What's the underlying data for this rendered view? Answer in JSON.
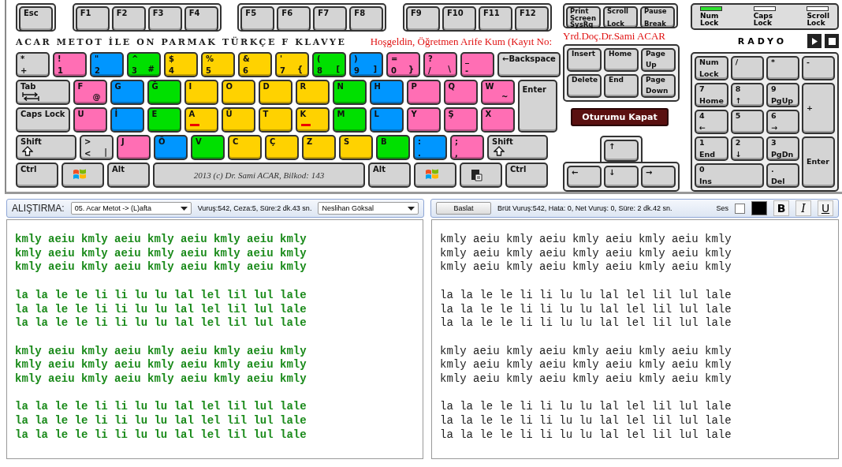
{
  "function_keys": [
    [
      {
        "label": [
          "Esc"
        ]
      }
    ],
    [
      {
        "label": [
          "F1"
        ]
      },
      {
        "label": [
          "F2"
        ]
      },
      {
        "label": [
          "F3"
        ]
      },
      {
        "label": [
          "F4"
        ]
      }
    ],
    [
      {
        "label": [
          "F5"
        ]
      },
      {
        "label": [
          "F6"
        ]
      },
      {
        "label": [
          "F7"
        ]
      },
      {
        "label": [
          "F8"
        ]
      }
    ],
    [
      {
        "label": [
          "F9"
        ]
      },
      {
        "label": [
          "F10"
        ]
      },
      {
        "label": [
          "F11"
        ]
      },
      {
        "label": [
          "F12"
        ]
      }
    ]
  ],
  "system_keys": [
    {
      "label": [
        "Print",
        "Screen",
        "SysRq"
      ]
    },
    {
      "label": [
        "Scroll",
        "Lock"
      ]
    },
    {
      "label": [
        "Pause",
        "Break"
      ]
    }
  ],
  "lock_indicators": [
    {
      "label": [
        "Num",
        "Lock"
      ],
      "on": true
    },
    {
      "label": [
        "Caps",
        "Lock"
      ],
      "on": false
    },
    {
      "label": [
        "Scroll",
        "Lock"
      ],
      "on": false
    }
  ],
  "title": "ACAR METOT İLE ON PARMAK TÜRKÇE F KLAVYE",
  "greeting": "Hoşgeldin, Öğretmen Arife Kum (Kayıt No:",
  "author": "Yrd.Doç.Dr.Sami ACAR",
  "radio": {
    "label": "RADYO"
  },
  "main_keys": {
    "number_row": [
      {
        "label": [
          "*",
          "+"
        ]
      },
      {
        "label": [
          "!",
          "1"
        ],
        "color": "#ff6eb4"
      },
      {
        "label": [
          "\"",
          "2"
        ],
        "color": "#0096ff"
      },
      {
        "label": [
          "^",
          "3"
        ],
        "alt": "#",
        "color": "#00e000"
      },
      {
        "label": [
          "$",
          "4"
        ],
        "color": "#ffd200"
      },
      {
        "label": [
          "%",
          "5"
        ],
        "color": "#ffd200"
      },
      {
        "label": [
          "&",
          "6"
        ],
        "color": "#ffd200"
      },
      {
        "label": [
          "'",
          "7"
        ],
        "alt": "{",
        "color": "#ffd200"
      },
      {
        "label": [
          "(",
          "8"
        ],
        "alt": "[",
        "color": "#00e000"
      },
      {
        "label": [
          ")",
          "9"
        ],
        "alt": "]",
        "color": "#0096ff"
      },
      {
        "label": [
          "=",
          "0"
        ],
        "alt": "}",
        "color": "#ff6eb4"
      },
      {
        "label": [
          "?",
          "/"
        ],
        "alt": "\\",
        "color": "#ff6eb4"
      },
      {
        "label": [
          "_",
          "-"
        ],
        "color": "#ff6eb4"
      },
      {
        "label": [
          "←Backspace"
        ],
        "kind": "wide"
      }
    ],
    "tab_row": [
      {
        "label": [
          "Tab"
        ],
        "kind": "tab"
      },
      {
        "label": [
          "F"
        ],
        "alt": "@",
        "color": "#ff6eb4"
      },
      {
        "label": [
          "G"
        ],
        "color": "#0096ff"
      },
      {
        "label": [
          "Ğ"
        ],
        "color": "#00e000"
      },
      {
        "label": [
          "I"
        ],
        "color": "#ffd200"
      },
      {
        "label": [
          "O"
        ],
        "color": "#ffd200"
      },
      {
        "label": [
          "D"
        ],
        "color": "#ffd200"
      },
      {
        "label": [
          "R"
        ],
        "color": "#ffd200"
      },
      {
        "label": [
          "N"
        ],
        "color": "#00e000"
      },
      {
        "label": [
          "H"
        ],
        "color": "#0096ff"
      },
      {
        "label": [
          "P"
        ],
        "color": "#ff6eb4"
      },
      {
        "label": [
          "Q"
        ],
        "color": "#ff6eb4"
      },
      {
        "label": [
          "W"
        ],
        "alt": "~",
        "color": "#ff6eb4"
      }
    ],
    "caps_row": [
      {
        "label": [
          "Caps Lock"
        ],
        "kind": "wide"
      },
      {
        "label": [
          "U"
        ],
        "color": "#ff6eb4"
      },
      {
        "label": [
          "İ"
        ],
        "color": "#0096ff"
      },
      {
        "label": [
          "E"
        ],
        "color": "#00e000"
      },
      {
        "label": [
          "A"
        ],
        "color": "#ffd200",
        "marker": true
      },
      {
        "label": [
          "Ü"
        ],
        "color": "#ffd200"
      },
      {
        "label": [
          "T"
        ],
        "color": "#ffd200"
      },
      {
        "label": [
          "K"
        ],
        "color": "#ffd200",
        "marker": true
      },
      {
        "label": [
          "M"
        ],
        "color": "#00e000"
      },
      {
        "label": [
          "L"
        ],
        "color": "#0096ff"
      },
      {
        "label": [
          "Y"
        ],
        "color": "#ff6eb4"
      },
      {
        "label": [
          "Ş"
        ],
        "color": "#ff6eb4"
      },
      {
        "label": [
          "X"
        ],
        "color": "#ff6eb4"
      }
    ],
    "enter": {
      "label": [
        "Enter"
      ]
    },
    "shift_row": [
      {
        "label": [
          "Shift"
        ],
        "kind": "shift"
      },
      {
        "label": [
          ">",
          "<"
        ],
        "alt": "|"
      },
      {
        "label": [
          "J"
        ],
        "color": "#ff6eb4"
      },
      {
        "label": [
          "Ö"
        ],
        "color": "#0096ff"
      },
      {
        "label": [
          "V"
        ],
        "color": "#00e000"
      },
      {
        "label": [
          "C"
        ],
        "color": "#ffd200"
      },
      {
        "label": [
          "Ç"
        ],
        "color": "#ffd200"
      },
      {
        "label": [
          "Z"
        ],
        "color": "#ffd200"
      },
      {
        "label": [
          "S"
        ],
        "color": "#ffd200"
      },
      {
        "label": [
          "B"
        ],
        "color": "#00e000"
      },
      {
        "label": [
          ":",
          "."
        ],
        "color": "#0096ff"
      },
      {
        "label": [
          ";",
          ","
        ],
        "color": "#ff6eb4"
      },
      {
        "label": [
          "Shift"
        ],
        "kind": "shift"
      }
    ],
    "bottom_row": [
      {
        "label": [
          "Ctrl"
        ],
        "kind": "mod"
      },
      {
        "kind": "logo"
      },
      {
        "label": [
          "Alt"
        ],
        "kind": "mod"
      },
      {
        "label": [
          "2013 (c) Dr. Sami ACAR, Bilkod: 143"
        ],
        "kind": "space"
      },
      {
        "label": [
          "Alt"
        ],
        "kind": "mod"
      },
      {
        "kind": "logo"
      },
      {
        "kind": "menu"
      },
      {
        "label": [
          "Ctrl"
        ],
        "kind": "mod"
      }
    ]
  },
  "nav_keys": [
    {
      "label": [
        "Insert"
      ]
    },
    {
      "label": [
        "Home"
      ]
    },
    {
      "label": [
        "Page",
        "Up"
      ]
    },
    {
      "label": [
        "Delete"
      ]
    },
    {
      "label": [
        "End"
      ]
    },
    {
      "label": [
        "Page",
        "Down"
      ]
    }
  ],
  "logout_button": "Oturumu Kapat",
  "arrow_keys": [
    {
      "label": [
        "↑"
      ]
    },
    {
      "label": [
        "←"
      ]
    },
    {
      "label": [
        "↓"
      ]
    },
    {
      "label": [
        "→"
      ]
    }
  ],
  "numpad_keys": [
    {
      "label": [
        "Num",
        "Lock"
      ]
    },
    {
      "label": [
        "/"
      ]
    },
    {
      "label": [
        "*"
      ]
    },
    {
      "label": [
        "-"
      ]
    },
    {
      "label": [
        "7",
        "Home"
      ]
    },
    {
      "label": [
        "8",
        "↑"
      ]
    },
    {
      "label": [
        "9",
        "PgUp"
      ]
    },
    {
      "label": [
        "+"
      ],
      "kind": "tall"
    },
    {
      "label": [
        "4",
        "←"
      ]
    },
    {
      "label": [
        "5"
      ]
    },
    {
      "label": [
        "6",
        "→"
      ]
    },
    {
      "label": [
        "1",
        "End"
      ]
    },
    {
      "label": [
        "2",
        "↓"
      ]
    },
    {
      "label": [
        "3",
        "PgDn"
      ]
    },
    {
      "label": [
        "Enter"
      ],
      "kind": "tall"
    },
    {
      "label": [
        "0",
        "Ins"
      ],
      "kind": "long"
    },
    {
      "label": [
        ".",
        "Del"
      ]
    }
  ],
  "exercise_bar": {
    "label": "ALIŞTIRMA:",
    "exercise": "05. Acar Metot -> (L)afta",
    "stats": "Vuruş:542, Ceza:5, Süre:2 dk.43 sn.",
    "student": "Neslihan Göksal"
  },
  "control_bar": {
    "start_button": "Baslat",
    "stats": "Brüt Vuruş:542, Hata: 0, Net Vuruş: 0, Süre: 2 dk.42 sn.",
    "sound": {
      "label": "Ses",
      "checked": false
    },
    "color_picker": {
      "color": "#000000"
    },
    "format_buttons": [
      {
        "label": "B",
        "selected": false
      },
      {
        "label": "I",
        "selected": false
      },
      {
        "label": "U",
        "selected": false
      }
    ]
  },
  "source_pane": {
    "groups": [
      [
        "kmly aeiu kmly aeiu kmly aeiu kmly aeiu kmly",
        "kmly aeiu kmly aeiu kmly aeiu kmly aeiu kmly",
        "kmly aeiu kmly aeiu kmly aeiu kmly aeiu kmly"
      ],
      [
        "la la le le li li lu lu lal lel lil lul lale",
        "la la le le li li lu lu lal lel lil lul lale",
        "la la le le li li lu lu lal lel lil lul lale"
      ],
      [
        "kmly aeiu kmly aeiu kmly aeiu kmly aeiu kmly",
        "kmly aeiu kmly aeiu kmly aeiu kmly aeiu kmly",
        "kmly aeiu kmly aeiu kmly aeiu kmly aeiu kmly"
      ],
      [
        "la la le le li li lu lu lal lel lil lul lale",
        "la la le le li li lu lu lal lel lil lul lale",
        "la la le le li li lu lu lal lel lil lul lale"
      ]
    ]
  },
  "typing_pane": {
    "groups": [
      [
        "kmly aeiu kmly aeiu kmly aeiu kmly aeiu kmly",
        "kmly aeiu kmly aeiu kmly aeiu kmly aeiu kmly",
        "kmly aeiu kmly aeiu kmly aeiu kmly aeiu kmly"
      ],
      [
        "la la le le li li lu lu lal lel lil lul lale",
        "la la le le li li lu lu lal lel lil lul lale",
        "la la le le li li lu lu lal lel lil lul lale"
      ],
      [
        "kmly aeiu kmly aeiu kmly aeiu kmly aeiu kmly",
        "kmly aeiu kmly aeiu kmly aeiu kmly aeiu kmly",
        "kmly aeiu kmly aeiu kmly aeiu kmly aeiu kmly"
      ],
      [
        "la la le le li li lu lu lal lel lil lul lale",
        "la la le le li li lu lu lal lel lil lul lale",
        "la la le le li li lu lu lal lel lil lul lale"
      ]
    ]
  }
}
